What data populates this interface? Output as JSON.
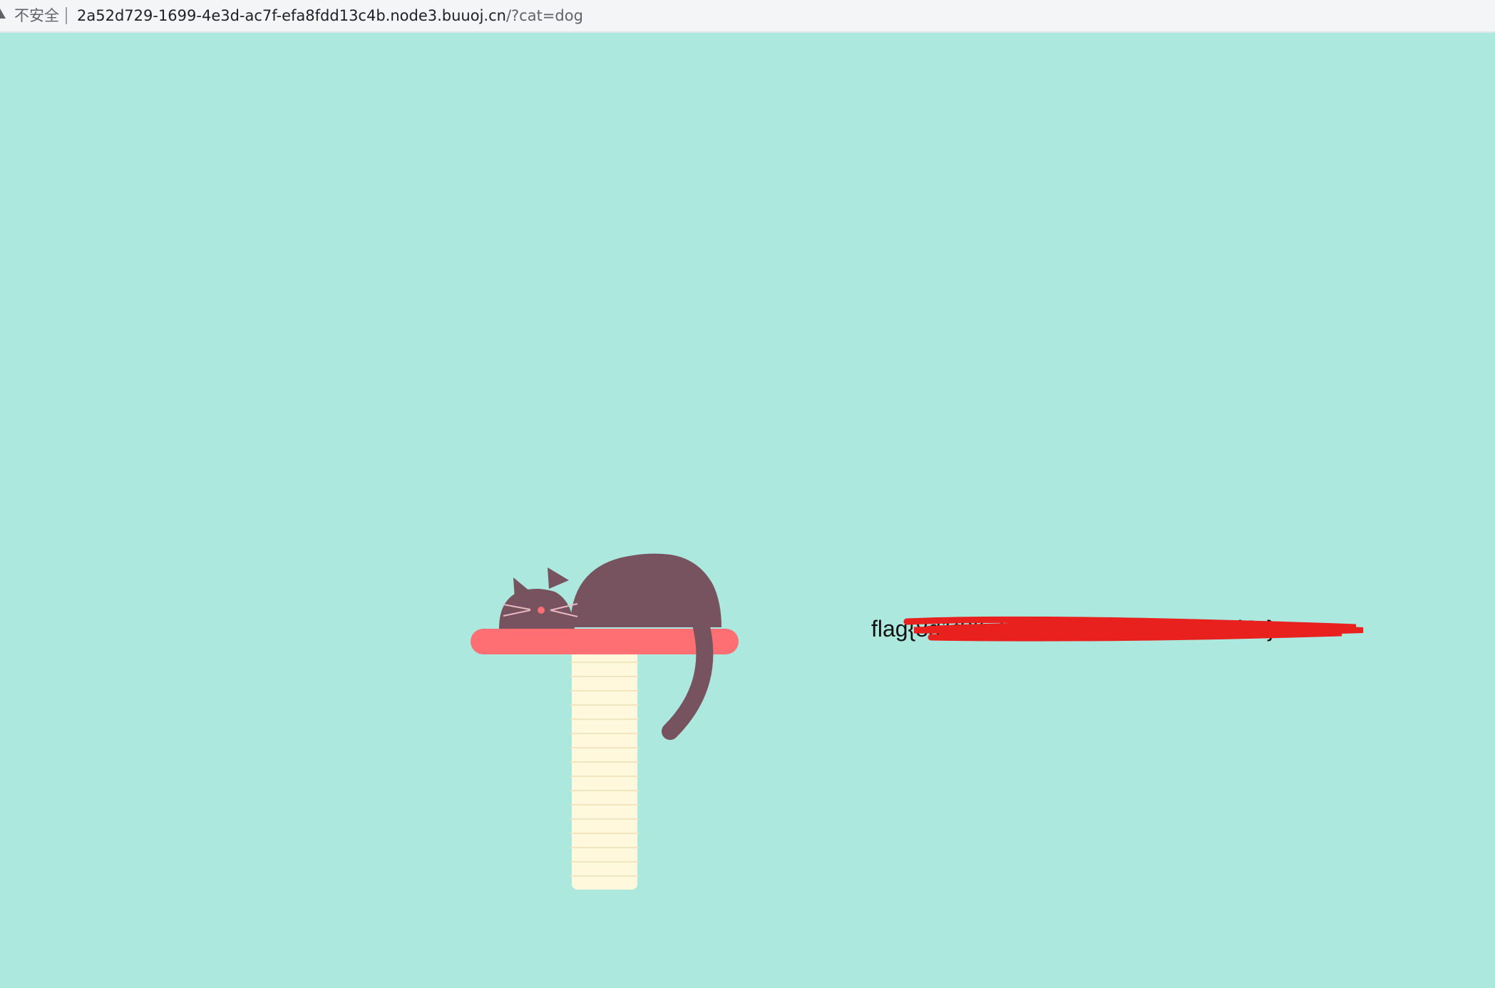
{
  "browser": {
    "security_label": "不安全",
    "url_host": "2a52d729-1699-4e3d-ac7f-efa8fdd13c4b.node3.buuoj.cn",
    "url_path": "/?cat=dog",
    "warning_icon": "warning-triangle-icon"
  },
  "page": {
    "background_color": "#ade8de",
    "flag_text": "flag{8d1f8f57-   d2d-a9b9-05b700dc7f7a}",
    "redaction_color": "#e8201e"
  },
  "illustration": {
    "cat_color": "#77525f",
    "perch_color": "#fd6f72",
    "post_color": "#fff8dc"
  }
}
